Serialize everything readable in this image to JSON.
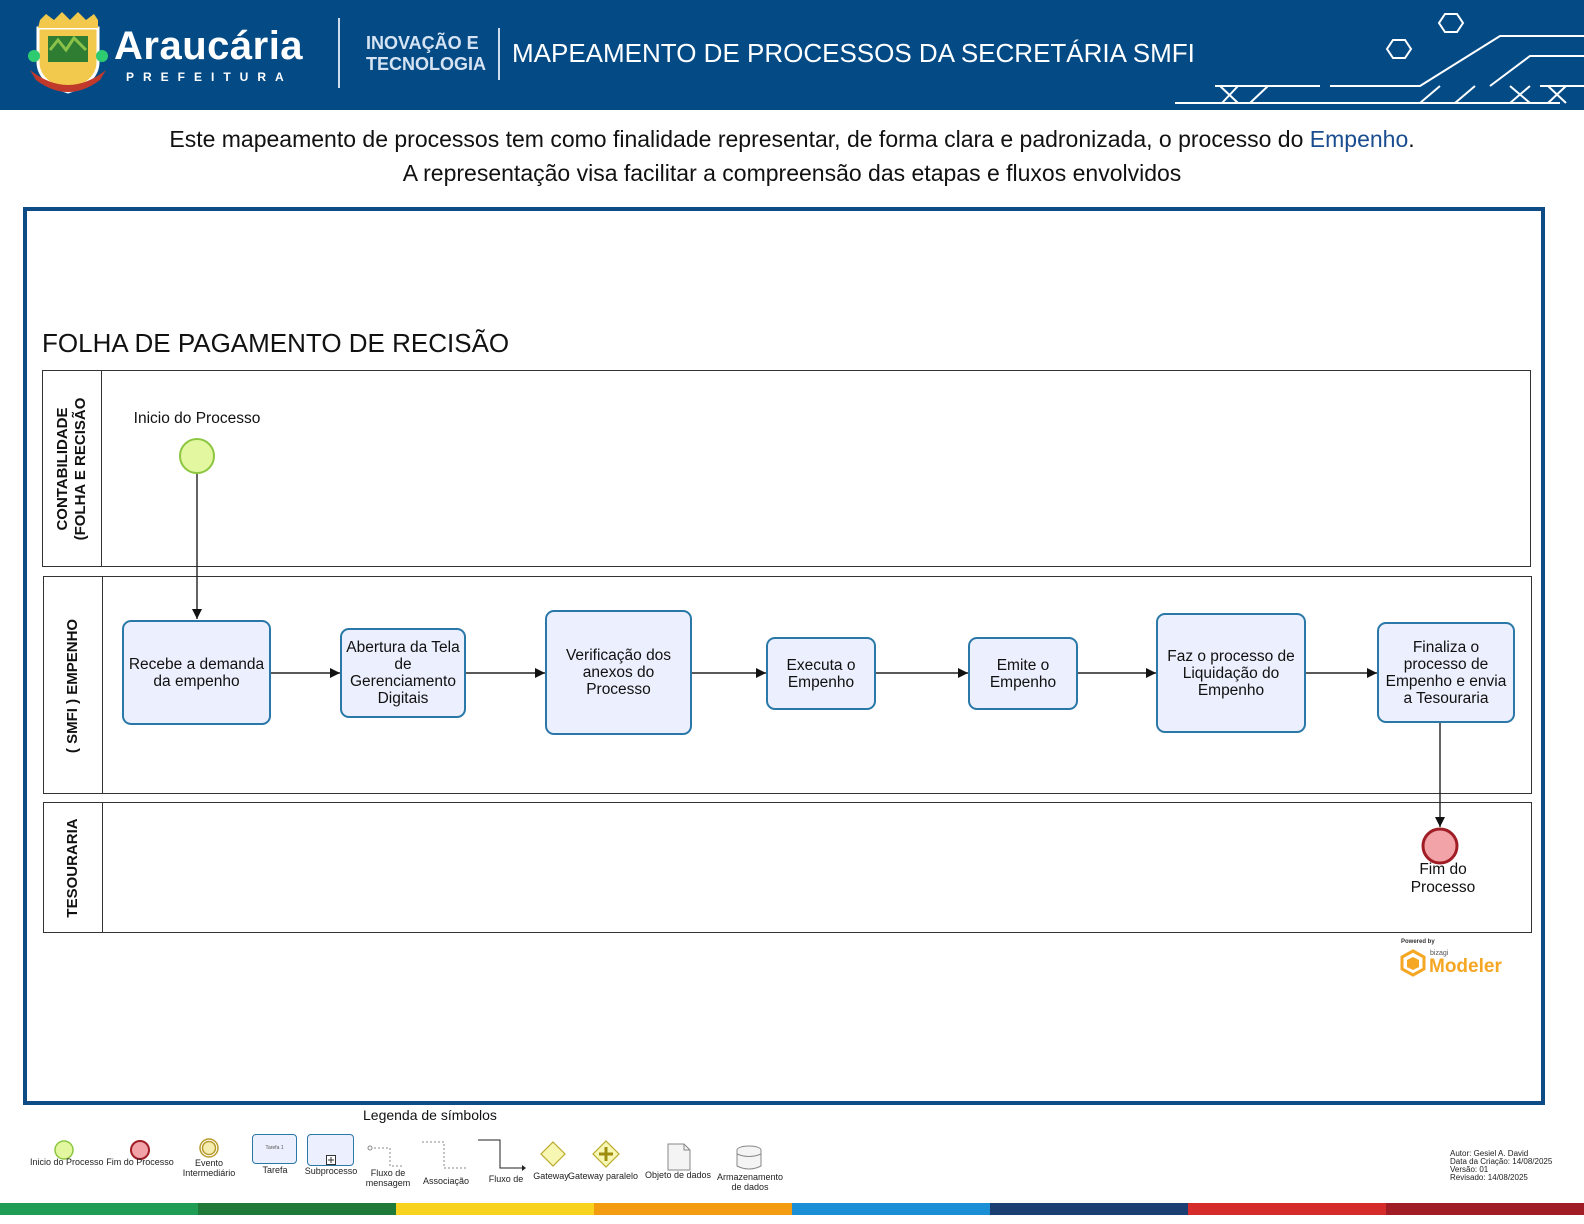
{
  "header": {
    "logo_name": "Araucária",
    "logo_subtitle": "PREFEITURA",
    "unit_line1": "INOVAÇÃO E",
    "unit_line2": "TECNOLOGIA",
    "title": "MAPEAMENTO DE PROCESSOS DA SECRETÁRIA SMFI",
    "bg_color": "#044b86"
  },
  "intro": {
    "part1": "Este mapeamento de processos tem como finalidade representar, de forma clara e padronizada, o processo do ",
    "highlight": "Empenho",
    "part2": ". A representação visa facilitar a compreensão das etapas e fluxos envolvidos"
  },
  "process": {
    "title": "FOLHA DE PAGAMENTO DE RECISÃO",
    "lanes": [
      {
        "label_line1": "CONTABILIDADE",
        "label_line2": "(FOLHA E RECISÃO"
      },
      {
        "label": "( SMFI ) EMPENHO"
      },
      {
        "label": "TESOURARIA"
      }
    ],
    "start_event": {
      "label": "Inicio do Processo",
      "color": "#e3f7a0"
    },
    "end_event": {
      "label_line1": "Fim do",
      "label_line2": "Processo",
      "color": "#f1a3a7"
    },
    "tasks": [
      {
        "label": "Recebe a demanda da empenho"
      },
      {
        "label": "Abertura da Tela de Gerenciamento Digitais"
      },
      {
        "label": "Verificação dos anexos do Processo"
      },
      {
        "label": "Executa o Empenho"
      },
      {
        "label": "Emite o Empenho"
      },
      {
        "label": "Faz o processo de Liquidação do Empenho"
      },
      {
        "label": "Finaliza o processo de Empenho e envia a Tesouraria"
      }
    ]
  },
  "branding": {
    "powered_by": "Powered by",
    "vendor": "bizagi",
    "product": "Modeler"
  },
  "legend": {
    "title": "Legenda de símbolos",
    "items": [
      "Inicio do Processo",
      "Fim do Processo",
      "Evento Intermediário",
      "Tarefa",
      "Subprocesso",
      "Fluxo de mensagem",
      "Associação",
      "Fluxo de",
      "Gateway",
      "Gateway paralelo",
      "Objeto de dados",
      "Armazenamento de dados"
    ],
    "task_sample_text": "Tarefa 1"
  },
  "meta": {
    "author": "Autor: Gesiel A. David",
    "created": "Data da Criação: 14/08/2025",
    "version": "Versão: 01",
    "revised": "Revisado: 14/08/2025"
  },
  "colors": {
    "task_fill": "#eceffd",
    "task_border": "#2a78a8",
    "frame_border": "#0f4c85",
    "bottom_bar": [
      "#1f9d55",
      "#f7d21e",
      "#f39c12",
      "#1a8fd6",
      "#1b3f73",
      "#d62b2b",
      "#a01d26"
    ]
  }
}
